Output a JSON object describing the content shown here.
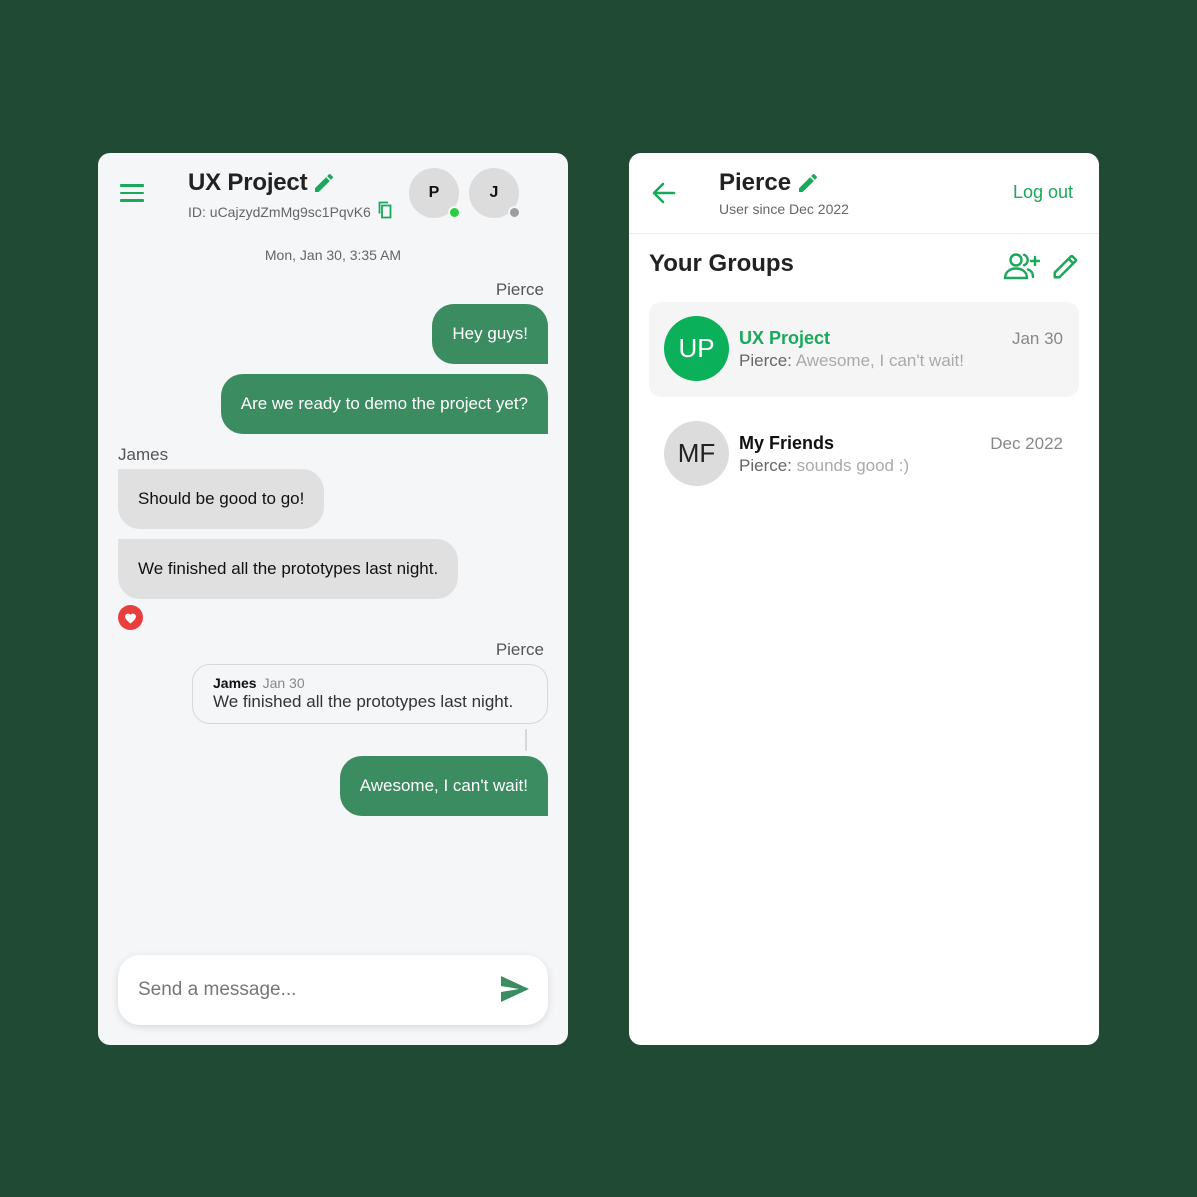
{
  "colors": {
    "background": "#204a33",
    "accent": "#1aa85a",
    "outgoing_bubble": "#3b8c60",
    "incoming_bubble": "#e0e0e0",
    "online": "#2ecc40",
    "offline": "#9e9e9e",
    "reaction": "#e83e3e"
  },
  "chat": {
    "title": "UX Project",
    "id_label": "ID: uCajzydZmMg9sc1PqvK6",
    "members": [
      {
        "initial": "P",
        "status": "online"
      },
      {
        "initial": "J",
        "status": "offline"
      }
    ],
    "timestamp": "Mon, Jan 30, 3:35 AM",
    "messages": {
      "sender_pierce_1": "Pierce",
      "m1": "Hey guys!",
      "m2": "Are we ready to demo the project yet?",
      "sender_james": "James",
      "m3": "Should be good to go!",
      "m4": "We finished all the prototypes last night.",
      "m4_reaction": "heart-icon",
      "sender_pierce_2": "Pierce",
      "reply": {
        "name": "James",
        "date": "Jan 30",
        "text": "We finished all the prototypes last night."
      },
      "m5": "Awesome, I can't wait!"
    },
    "composer": {
      "placeholder": "Send a message...",
      "send_icon": "send-icon"
    }
  },
  "profile": {
    "name": "Pierce",
    "since": "User since Dec 2022",
    "logout_label": "Log out",
    "section_title": "Your Groups",
    "groups": [
      {
        "initials": "UP",
        "name": "UX Project",
        "date": "Jan 30",
        "preview_author": "Pierce:",
        "preview_text": "Awesome, I can't wait!",
        "active": true
      },
      {
        "initials": "MF",
        "name": "My Friends",
        "date": "Dec 2022",
        "preview_author": "Pierce:",
        "preview_text": "sounds good :)",
        "active": false
      }
    ]
  }
}
